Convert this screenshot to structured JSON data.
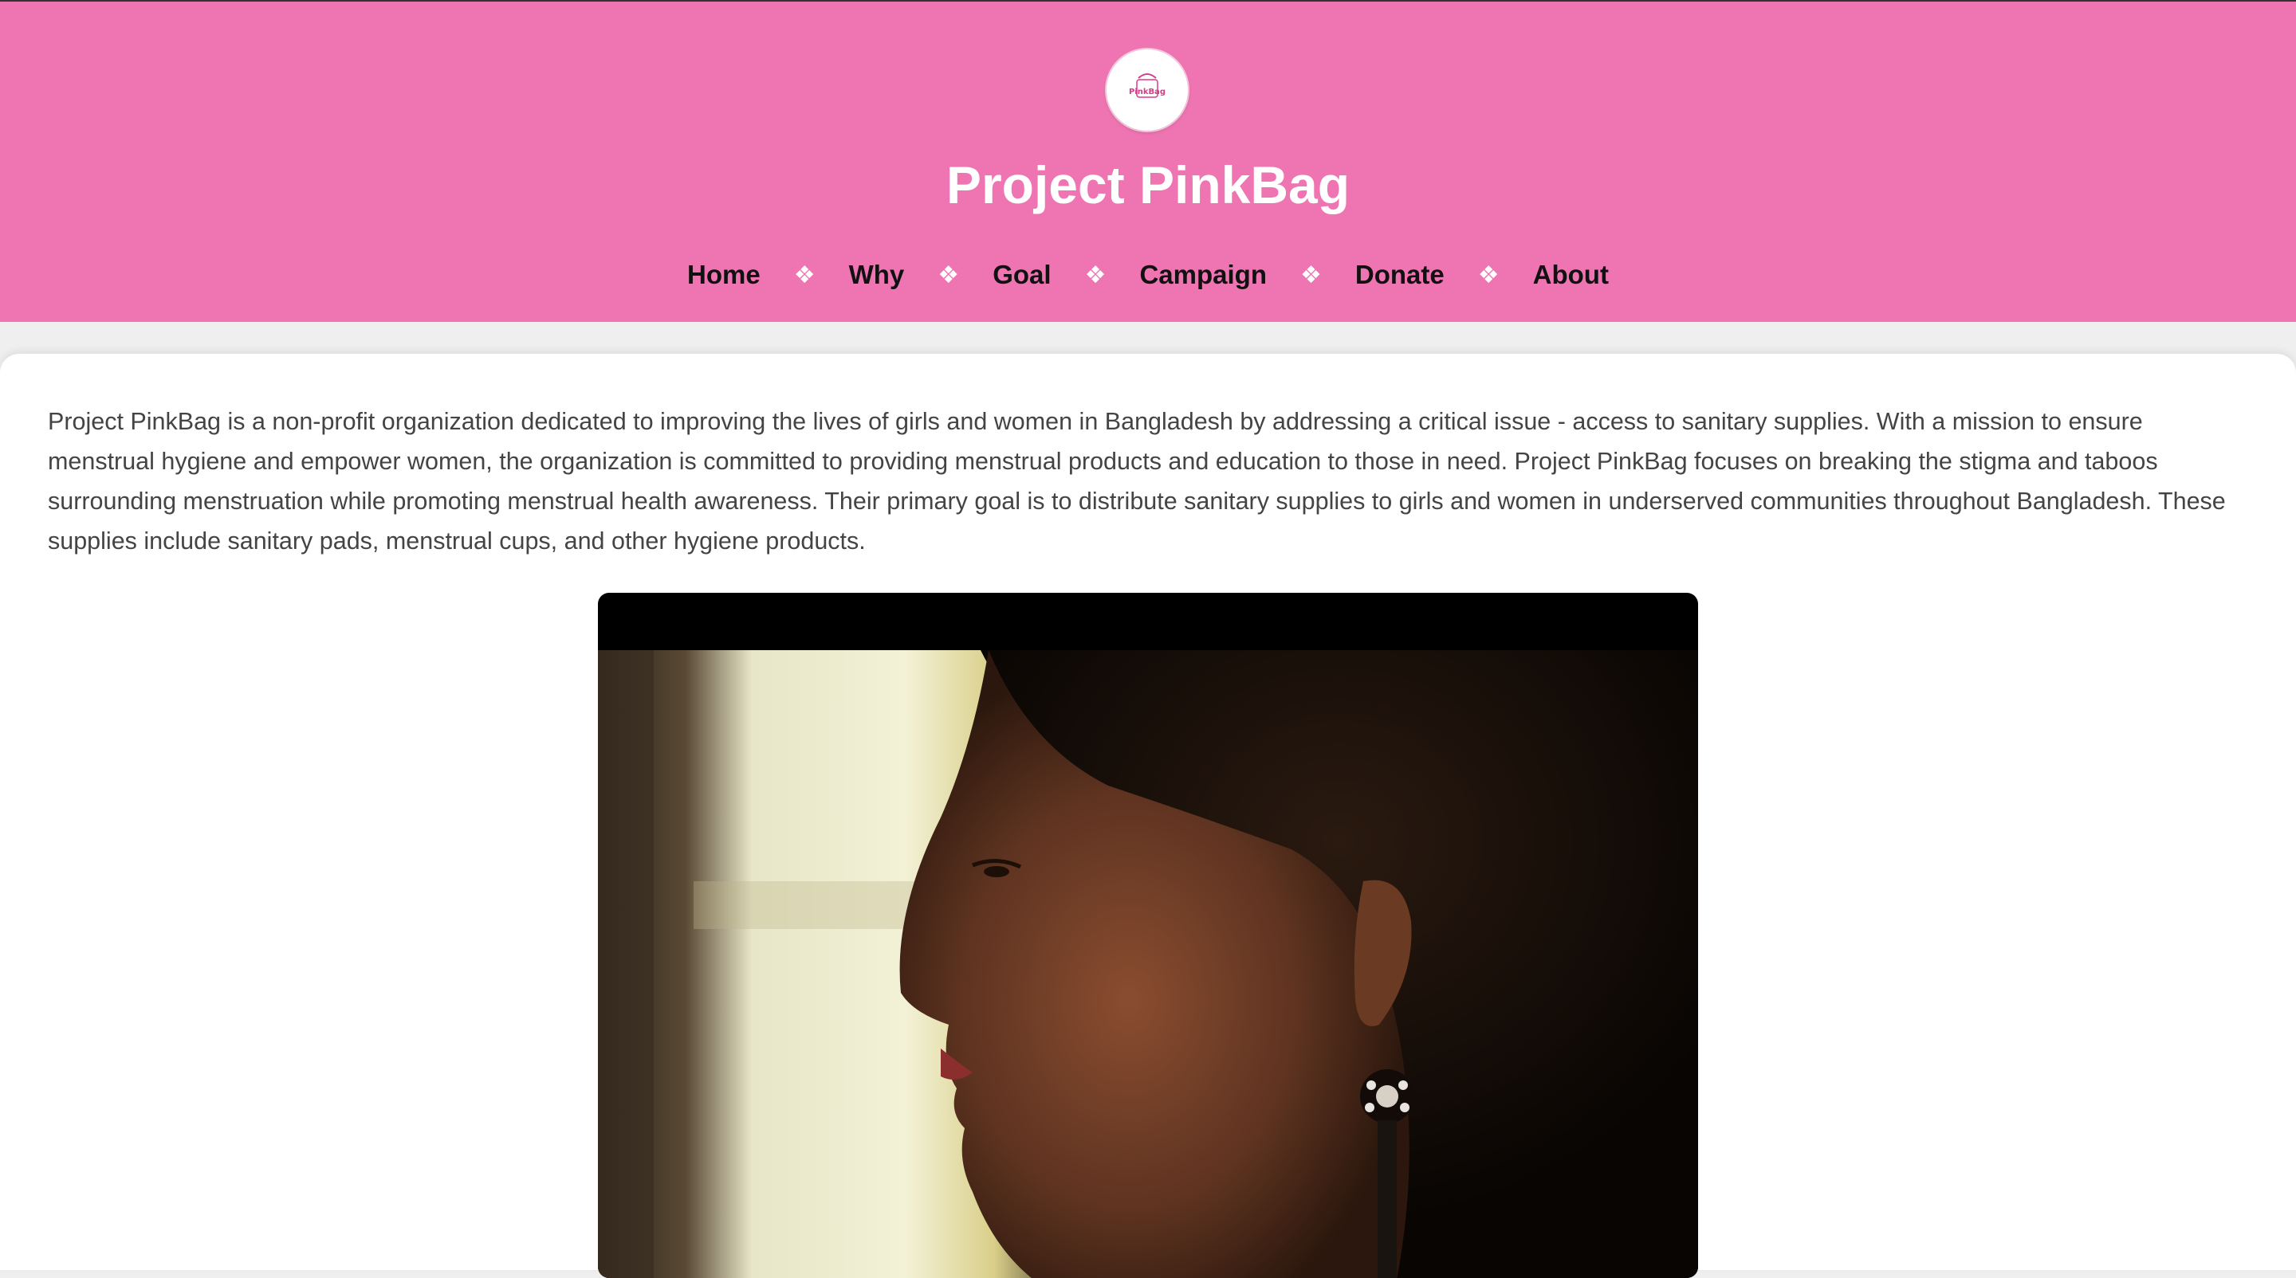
{
  "site": {
    "logo_text": "PinkBag",
    "title": "Project PinkBag"
  },
  "nav": {
    "separator": "❖",
    "items": [
      {
        "label": "Home"
      },
      {
        "label": "Why"
      },
      {
        "label": "Goal"
      },
      {
        "label": "Campaign"
      },
      {
        "label": "Donate"
      },
      {
        "label": "About"
      }
    ]
  },
  "main": {
    "intro": "Project PinkBag is a non-profit organization dedicated to improving the lives of girls and women in Bangladesh by addressing a critical issue - access to sanitary supplies. With a mission to ensure menstrual hygiene and empower women, the organization is committed to providing menstrual products and education to those in need. Project PinkBag focuses on breaking the stigma and taboos surrounding menstruation while promoting menstrual health awareness. Their primary goal is to distribute sanitary supplies to girls and women in underserved communities throughout Bangladesh. These supplies include sanitary pads, menstrual cups, and other hygiene products."
  },
  "colors": {
    "header": "#ef75b2",
    "title": "#ffffff",
    "nav_link": "#111111",
    "body_text": "#444444"
  }
}
